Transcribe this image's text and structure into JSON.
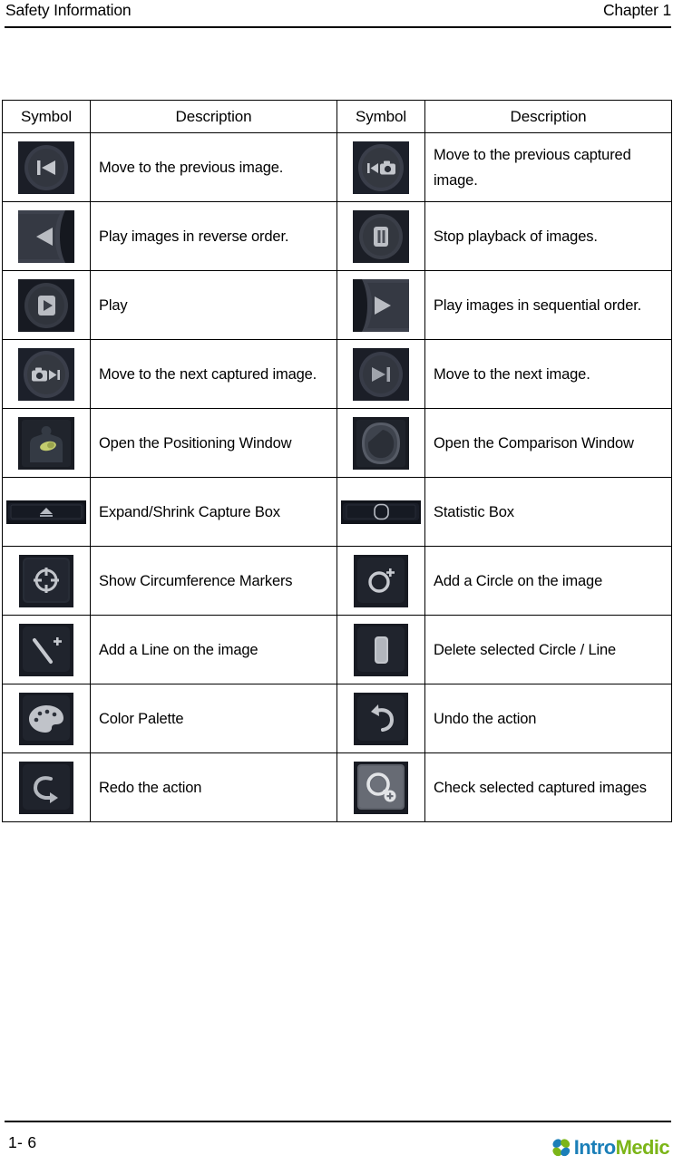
{
  "header": {
    "left_title": "Safety Information",
    "right_title": "Chapter 1"
  },
  "table": {
    "columns": [
      "Symbol",
      "Description",
      "Symbol",
      "Description"
    ],
    "rows": [
      {
        "left": {
          "icon": "skip-previous-icon",
          "description": "Move to the previous image."
        },
        "right": {
          "icon": "previous-captured-image-icon",
          "description": "Move to the previous captured image."
        }
      },
      {
        "left": {
          "icon": "play-reverse-icon",
          "description": "Play images in reverse order."
        },
        "right": {
          "icon": "pause-stop-icon",
          "description": "Stop playback of images."
        }
      },
      {
        "left": {
          "icon": "play-icon",
          "description": "Play"
        },
        "right": {
          "icon": "play-sequential-icon",
          "description": "Play images in sequential order."
        }
      },
      {
        "left": {
          "icon": "next-captured-image-icon",
          "description": "Move to the next captured image."
        },
        "right": {
          "icon": "skip-next-icon",
          "description": "Move to the next image."
        }
      },
      {
        "left": {
          "icon": "positioning-window-icon",
          "description": "Open the Positioning Window"
        },
        "right": {
          "icon": "comparison-window-icon",
          "description": "Open the Comparison Window"
        }
      },
      {
        "left": {
          "icon": "expand-shrink-capture-box-icon",
          "description": "Expand/Shrink Capture Box"
        },
        "right": {
          "icon": "statistic-box-icon",
          "description": "Statistic Box"
        }
      },
      {
        "left": {
          "icon": "circumference-markers-icon",
          "description": "Show Circumference Markers"
        },
        "right": {
          "icon": "add-circle-icon",
          "description": "Add a Circle on the image"
        }
      },
      {
        "left": {
          "icon": "add-line-icon",
          "description": "Add a Line on the image"
        },
        "right": {
          "icon": "delete-shape-icon",
          "description": "Delete selected Circle / Line"
        }
      },
      {
        "left": {
          "icon": "color-palette-icon",
          "description": "Color Palette"
        },
        "right": {
          "icon": "undo-icon",
          "description": "Undo the action"
        }
      },
      {
        "left": {
          "icon": "redo-icon",
          "description": "Redo the action"
        },
        "right": {
          "icon": "check-captured-images-icon",
          "description": "Check selected captured images"
        }
      }
    ]
  },
  "footer": {
    "page_number": "1- 6",
    "brand_first": "Intro",
    "brand_second": "Medic"
  },
  "colors": {
    "brand_blue": "#1b7fb8",
    "brand_green": "#7cb518",
    "icon_background": "#212530",
    "icon_glyph": "#b9bcc4",
    "rule": "#000000"
  }
}
